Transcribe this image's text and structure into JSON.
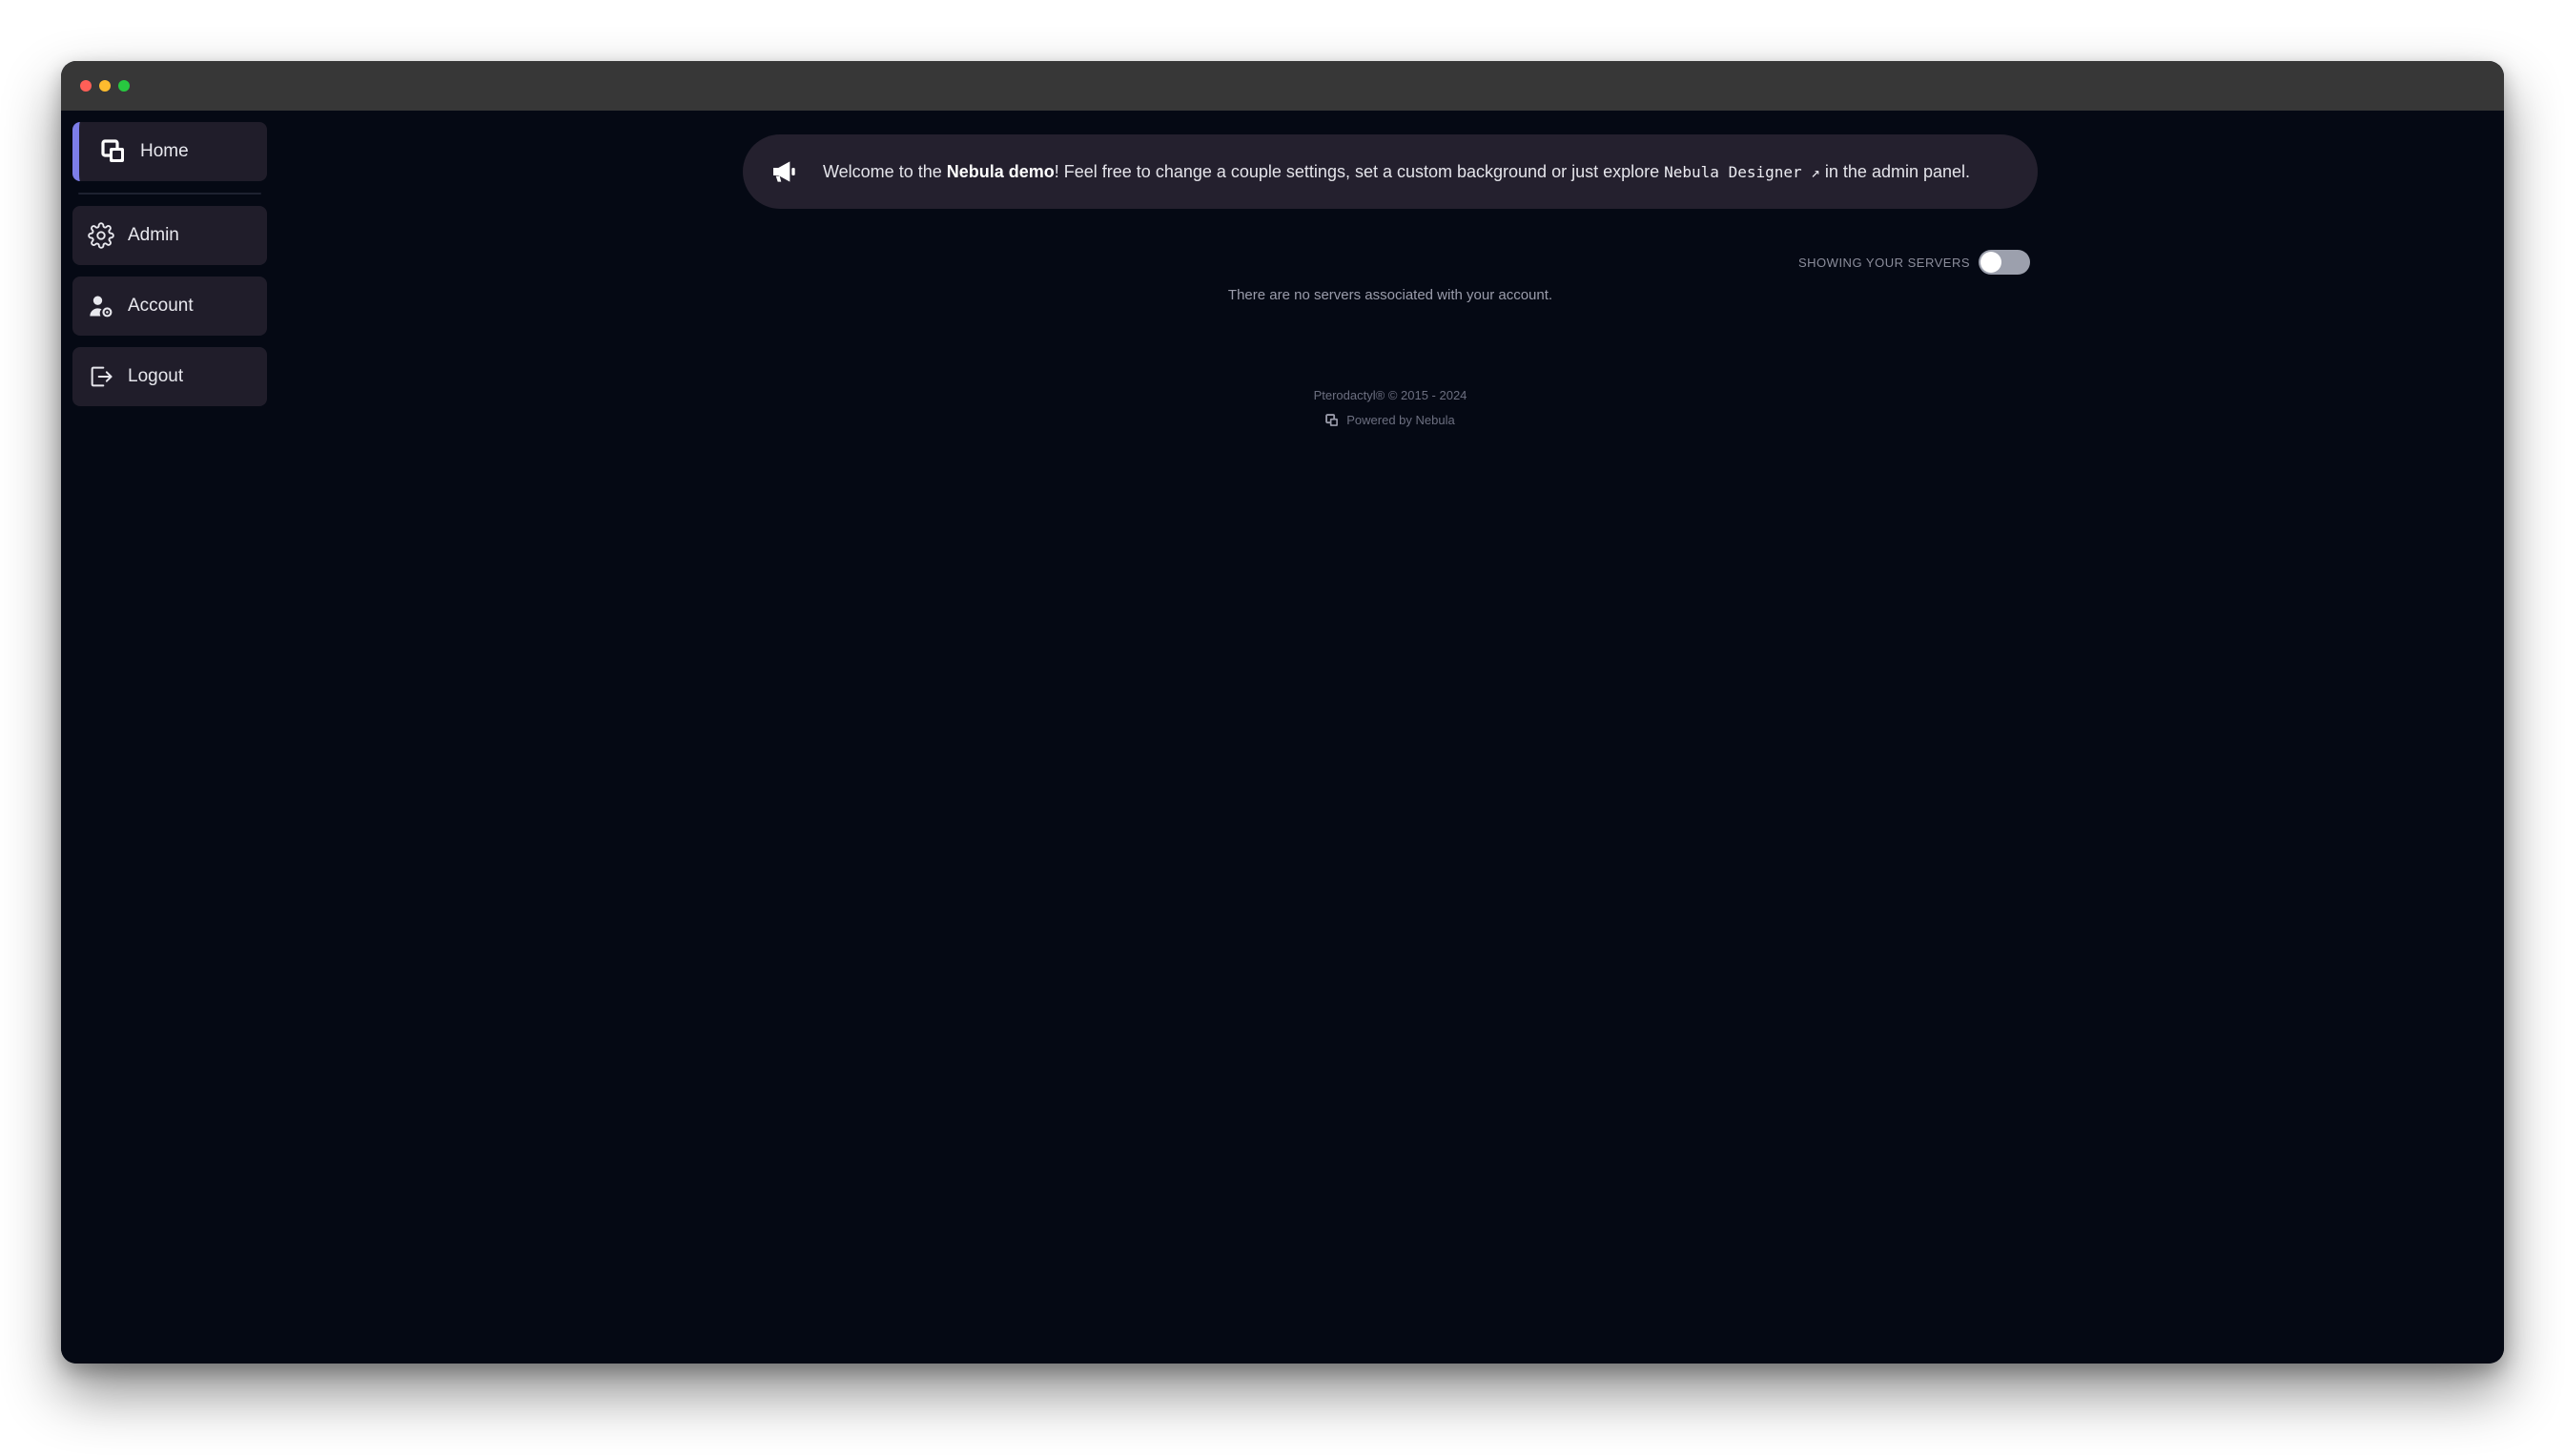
{
  "window": {
    "controls": [
      "close",
      "minimize",
      "maximize"
    ],
    "colors": {
      "close": "#fe5f57",
      "minimize": "#febc2e",
      "maximize": "#28c840",
      "background": "#050914",
      "card": "#201d2a",
      "accent": "#7c7de8"
    }
  },
  "sidebar": {
    "items": [
      {
        "label": "Home",
        "icon": "nebula-logo-icon",
        "active": true
      },
      {
        "label": "Admin",
        "icon": "gear-icon",
        "active": false
      },
      {
        "label": "Account",
        "icon": "user-gear-icon",
        "active": false
      },
      {
        "label": "Logout",
        "icon": "logout-icon",
        "active": false
      }
    ]
  },
  "announcement": {
    "icon": "megaphone-icon",
    "text_prefix": "Welcome to the ",
    "text_bold": "Nebula demo",
    "text_middle": "! Feel free to change a couple settings, set a custom background or just explore ",
    "text_code": "Nebula Designer ↗",
    "text_suffix": " in the admin panel."
  },
  "servers": {
    "toggle_label": "SHOWING YOUR SERVERS",
    "toggle_on": false,
    "empty_message": "There are no servers associated with your account."
  },
  "footer": {
    "copyright": "Pterodactyl® © 2015 - 2024",
    "powered_by": "Powered by Nebula"
  }
}
